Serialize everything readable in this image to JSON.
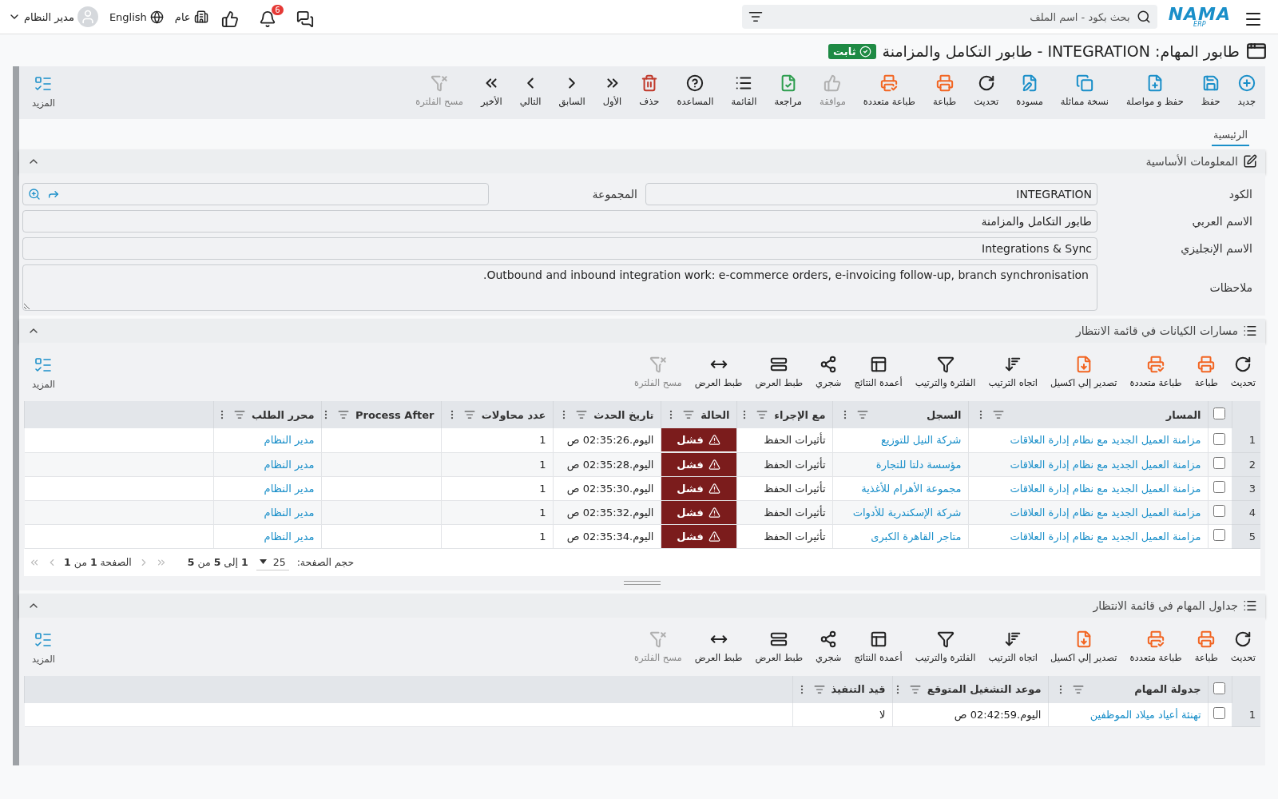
{
  "topbar": {
    "logo": {
      "name": "NAMA",
      "sub": "ERP"
    },
    "search": {
      "placeholder": "بحث بكود - اسم الملف"
    },
    "notifications": "6",
    "company": "عام",
    "language": "English",
    "user": "مدير النظام"
  },
  "title": {
    "text": "طابور المهام: INTEGRATION - طابور التكامل والمزامنة",
    "badge": "ثابت"
  },
  "toolbar": {
    "items": [
      {
        "label": "جديد",
        "color": "#1a8fc9",
        "disabled": false
      },
      {
        "label": "حفظ",
        "color": "#1a8fc9",
        "disabled": false
      },
      {
        "label": "حفظ و مواصلة",
        "color": "#1a8fc9",
        "disabled": false
      },
      {
        "label": "نسخة مماثلة",
        "color": "#1a8fc9",
        "disabled": false
      },
      {
        "label": "مسودة",
        "color": "#1a8fc9",
        "disabled": false
      },
      {
        "label": "تحديث",
        "color": "#222222",
        "disabled": false
      },
      {
        "label": "طباعة",
        "color": "#f26522",
        "disabled": false
      },
      {
        "label": "طباعة متعددة",
        "color": "#f26522",
        "disabled": false
      },
      {
        "label": "موافقة",
        "color": "#b0b0b0",
        "disabled": true
      },
      {
        "label": "مراجعة",
        "color": "#2e9e4f",
        "disabled": false
      },
      {
        "label": "القائمة",
        "color": "#222222",
        "disabled": false
      },
      {
        "label": "المساعدة",
        "color": "#222222",
        "disabled": false
      },
      {
        "label": "حذف",
        "color": "#c0392b",
        "disabled": false
      },
      {
        "label": "الأول",
        "color": "#222222",
        "disabled": false
      },
      {
        "label": "السابق",
        "color": "#222222",
        "disabled": false
      },
      {
        "label": "التالي",
        "color": "#222222",
        "disabled": false
      },
      {
        "label": "الأخير",
        "color": "#222222",
        "disabled": false
      },
      {
        "label": "مسح الفلترة",
        "color": "#b0b0b0",
        "disabled": true
      }
    ],
    "more": "المزيد"
  },
  "tabs": [
    {
      "label": "الرئيسية",
      "selected": true
    }
  ],
  "basic_info": {
    "title": "المعلومات الأساسية",
    "expanded": true,
    "fields": {
      "code": {
        "label": "الكود",
        "value": "INTEGRATION"
      },
      "group": {
        "label": "المجموعة"
      },
      "arabic_name": {
        "label": "الاسم العربي",
        "value": "طابور التكامل والمزامنة"
      },
      "english_name": {
        "label": "الاسم الإنجليزي",
        "value": "Integrations & Sync"
      },
      "notes": {
        "label": "ملاحظات",
        "value": "Outbound and inbound integration work: e-commerce orders, e-invoicing follow-up, branch synchronisation."
      }
    }
  },
  "entity_paths": {
    "title": "مسارات الكيانات في قائمة الانتظار",
    "expanded": true,
    "toolbar": {
      "items": [
        {
          "label": "تحديث",
          "color": "#222222",
          "disabled": false
        },
        {
          "label": "طباعة",
          "color": "#f26522",
          "disabled": false
        },
        {
          "label": "طباعة متعددة",
          "color": "#f26522",
          "disabled": false
        },
        {
          "label": "تصدير إلي اكسيل",
          "color": "#f26522",
          "disabled": false
        },
        {
          "label": "اتجاه الترتيب",
          "color": "#222222",
          "disabled": false
        },
        {
          "label": "الفلترة والترتيب",
          "color": "#222222",
          "disabled": false
        },
        {
          "label": "أعمدة النتائج",
          "color": "#222222",
          "disabled": false
        },
        {
          "label": "شجري",
          "color": "#222222",
          "disabled": false
        },
        {
          "label": "طبط العرض",
          "color": "#222222",
          "disabled": false
        },
        {
          "label": "طبط العرض",
          "color": "#222222",
          "disabled": false
        },
        {
          "label": "مسح الفلترة",
          "color": "#b0b0b0",
          "disabled": true
        }
      ],
      "more": "المزيد"
    },
    "table": {
      "select_all_checked": false,
      "columns": [
        {
          "label": "المسار",
          "kind": "link"
        },
        {
          "label": "السجل",
          "kind": "link"
        },
        {
          "label": "مع الإجراء",
          "kind": "text"
        },
        {
          "label": "الحالة",
          "kind": "status"
        },
        {
          "label": "تاريخ الحدث",
          "kind": "text"
        },
        {
          "label": "عدد محاولات",
          "kind": "text"
        },
        {
          "label": "Process After",
          "kind": "text"
        },
        {
          "label": "محرر الطلب",
          "kind": "link"
        }
      ],
      "rows": [
        {
          "number": "1",
          "checked": false,
          "cells": [
            "مزامنة العميل الجديد مع نظام إدارة العلاقات",
            "شركة النيل للتوزيع",
            "تأثيرات الحفظ",
            "فشل",
            "اليوم.02:35:26 ص",
            "1",
            "",
            "مدير النظام"
          ]
        },
        {
          "number": "2",
          "checked": false,
          "cells": [
            "مزامنة العميل الجديد مع نظام إدارة العلاقات",
            "مؤسسة دلتا للتجارة",
            "تأثيرات الحفظ",
            "فشل",
            "اليوم.02:35:28 ص",
            "1",
            "",
            "مدير النظام"
          ]
        },
        {
          "number": "3",
          "checked": false,
          "cells": [
            "مزامنة العميل الجديد مع نظام إدارة العلاقات",
            "مجموعة الأهرام للأغذية",
            "تأثيرات الحفظ",
            "فشل",
            "اليوم.02:35:30 ص",
            "1",
            "",
            "مدير النظام"
          ]
        },
        {
          "number": "4",
          "checked": false,
          "cells": [
            "مزامنة العميل الجديد مع نظام إدارة العلاقات",
            "شركة الإسكندرية للأدوات",
            "تأثيرات الحفظ",
            "فشل",
            "اليوم.02:35:32 ص",
            "1",
            "",
            "مدير النظام"
          ]
        },
        {
          "number": "5",
          "checked": false,
          "cells": [
            "مزامنة العميل الجديد مع نظام إدارة العلاقات",
            "متاجر القاهرة الكبرى",
            "تأثيرات الحفظ",
            "فشل",
            "اليوم.02:35:34 ص",
            "1",
            "",
            "مدير النظام"
          ]
        }
      ]
    },
    "pager": {
      "page_size_label": "حجم الصفحة:",
      "page_size": "25",
      "range": "**1** إلى **5** من **5**",
      "page": "الصفحة **1** من **1**"
    }
  },
  "task_schedules": {
    "title": "جداول المهام في قائمة الانتظار",
    "expanded": true,
    "toolbar": {
      "items": [
        {
          "label": "تحديث",
          "color": "#222222",
          "disabled": false
        },
        {
          "label": "طباعة",
          "color": "#f26522",
          "disabled": false
        },
        {
          "label": "طباعة متعددة",
          "color": "#f26522",
          "disabled": false
        },
        {
          "label": "تصدير إلي اكسيل",
          "color": "#f26522",
          "disabled": false
        },
        {
          "label": "اتجاه الترتيب",
          "color": "#222222",
          "disabled": false
        },
        {
          "label": "الفلترة والترتيب",
          "color": "#222222",
          "disabled": false
        },
        {
          "label": "أعمدة النتائج",
          "color": "#222222",
          "disabled": false
        },
        {
          "label": "شجري",
          "color": "#222222",
          "disabled": false
        },
        {
          "label": "طبط العرض",
          "color": "#222222",
          "disabled": false
        },
        {
          "label": "طبط العرض",
          "color": "#222222",
          "disabled": false
        },
        {
          "label": "مسح الفلترة",
          "color": "#b0b0b0",
          "disabled": true
        }
      ],
      "more": "المزيد"
    },
    "table": {
      "select_all_checked": false,
      "columns": [
        {
          "label": "جدولة المهام",
          "kind": "link"
        },
        {
          "label": "موعد التشغيل المتوقع",
          "kind": "text"
        },
        {
          "label": "قيد التنفيذ",
          "kind": "text"
        }
      ],
      "rows": [
        {
          "number": "1",
          "checked": false,
          "cells": [
            "تهنئة أعياد ميلاد الموظفين",
            "اليوم.02:42:59 ص",
            "لا"
          ]
        }
      ]
    }
  }
}
